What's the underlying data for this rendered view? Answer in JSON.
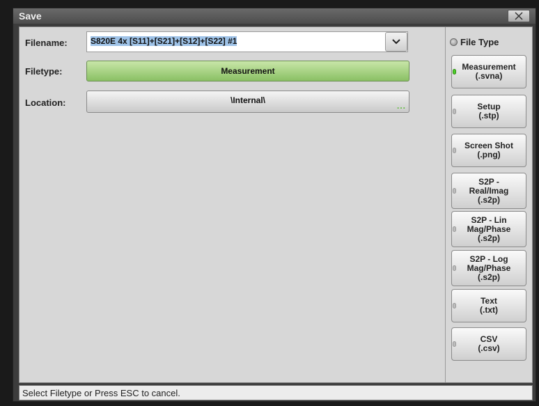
{
  "dialog": {
    "title": "Save",
    "close_symbol": "✕"
  },
  "form": {
    "filename_label": "Filename:",
    "filename_value": "S820E 4x [S11]+[S21]+[S12]+[S22] #1",
    "filetype_label": "Filetype:",
    "filetype_value": "Measurement",
    "location_label": "Location:",
    "location_value": "\\Internal\\",
    "location_more": "..."
  },
  "sidebar": {
    "header": "File Type",
    "buttons": [
      {
        "line1": "Measurement",
        "line2": "(.svna)",
        "line3": "",
        "active": true
      },
      {
        "line1": "Setup",
        "line2": "(.stp)",
        "line3": "",
        "active": false
      },
      {
        "line1": "Screen Shot",
        "line2": "(.png)",
        "line3": "",
        "active": false
      },
      {
        "line1": "S2P -",
        "line2": "Real/Imag",
        "line3": "(.s2p)",
        "active": false
      },
      {
        "line1": "S2P - Lin",
        "line2": "Mag/Phase",
        "line3": "(.s2p)",
        "active": false
      },
      {
        "line1": "S2P - Log",
        "line2": "Mag/Phase",
        "line3": "(.s2p)",
        "active": false
      },
      {
        "line1": "Text",
        "line2": "(.txt)",
        "line3": "",
        "active": false
      },
      {
        "line1": "CSV",
        "line2": "(.csv)",
        "line3": "",
        "active": false
      }
    ]
  },
  "status": {
    "message": "Select Filetype or Press ESC to cancel."
  },
  "icons": {
    "close": "close-icon",
    "dropdown": "chevron-down-icon",
    "radio": "radio-indicator-icon"
  },
  "colors": {
    "active_filetype": "#8ac064",
    "led_on": "#4fd02a"
  }
}
